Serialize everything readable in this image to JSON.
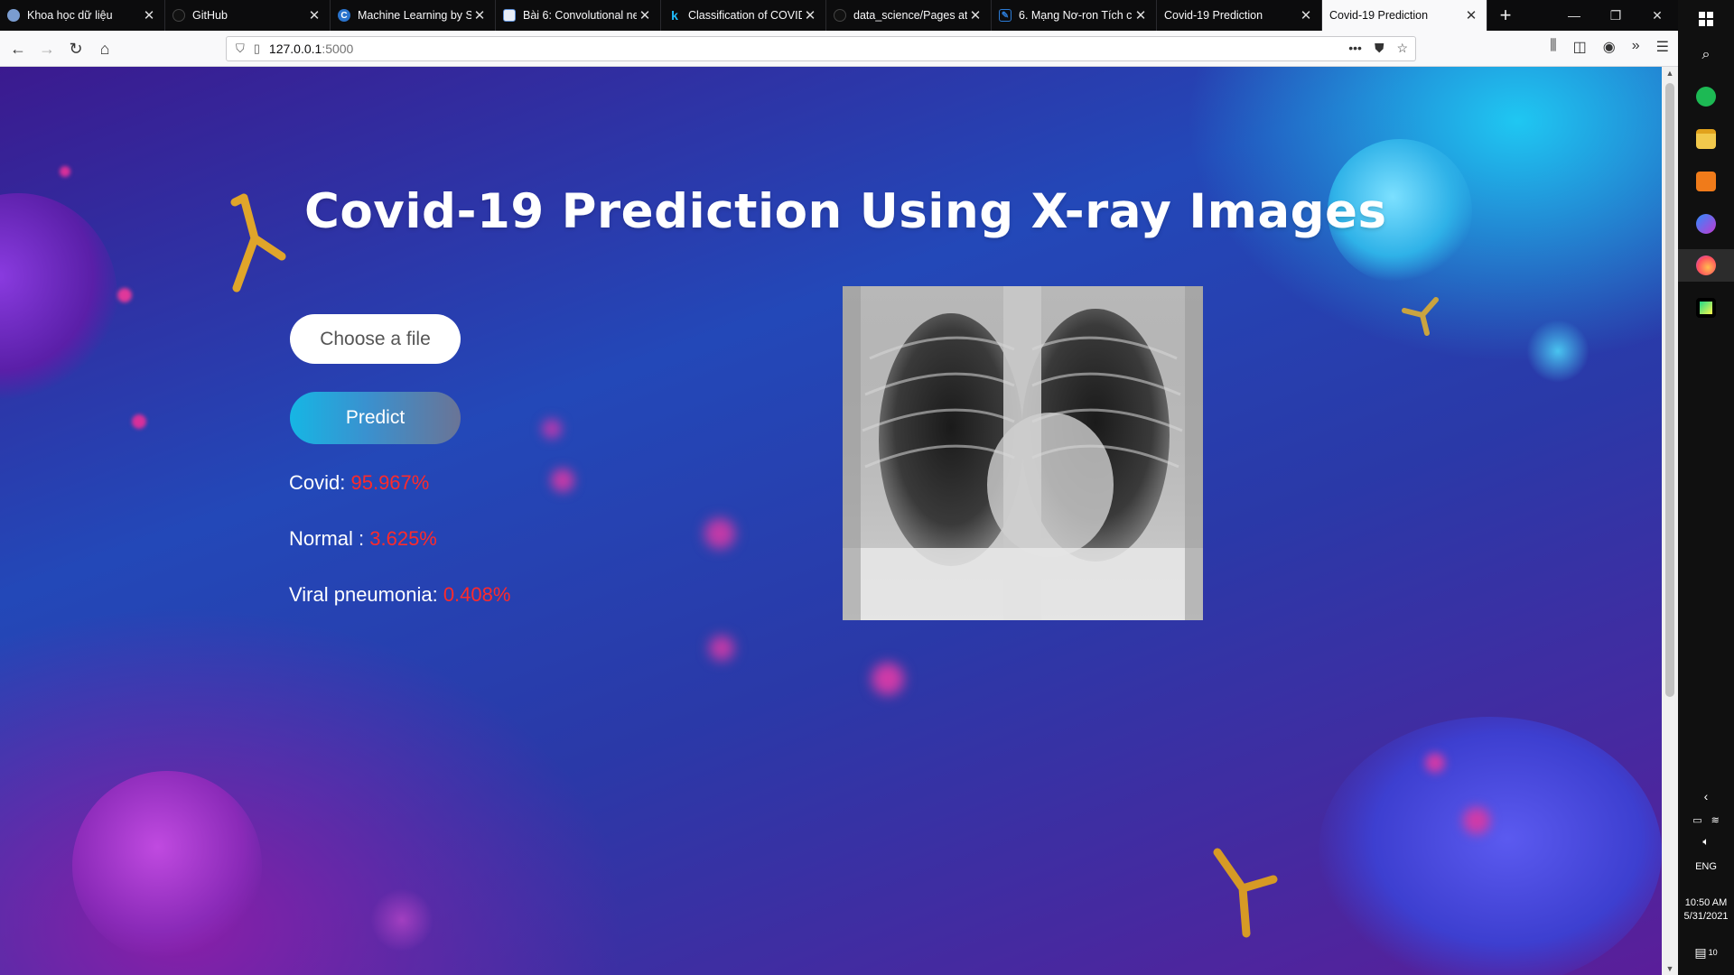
{
  "browser": {
    "tabs": [
      {
        "title": "Khoa học dữ liệu",
        "icon": "ai-logo-icon",
        "color": "#7a9cd0"
      },
      {
        "title": "GitHub",
        "icon": "github-icon",
        "color": "#111111"
      },
      {
        "title": "Machine Learning by S",
        "icon": "coursera-c-icon",
        "color": "#2a73cc"
      },
      {
        "title": "Bài 6: Convolutional ne",
        "icon": "document-icon",
        "color": "#5b8dd6"
      },
      {
        "title": "Classification of COVID",
        "icon": "kaggle-k-icon",
        "color": "#20beff"
      },
      {
        "title": "data_science/Pages at",
        "icon": "github-icon",
        "color": "#111111"
      },
      {
        "title": "6. Mạng Nơ-ron Tích c",
        "icon": "edit-icon",
        "color": "#2b7bd6"
      },
      {
        "title": "Covid-19 Prediction",
        "icon": "page-icon",
        "color": "#888888"
      },
      {
        "title": "Covid-19 Prediction",
        "icon": "page-icon",
        "color": "#888888",
        "active": true
      }
    ],
    "new_tab": "+",
    "url_host": "127.0.0.1",
    "url_port": ":5000"
  },
  "page": {
    "title": "Covid-19 Prediction Using X-ray Images",
    "choose_file_label": "Choose a file",
    "predict_label": "Predict",
    "results": [
      {
        "label": "Covid: ",
        "value": "95.967%"
      },
      {
        "label": "Normal : ",
        "value": "3.625%"
      },
      {
        "label": "Viral pneumonia: ",
        "value": "0.408%"
      }
    ]
  },
  "taskbar": {
    "lang": "ENG",
    "time": "10:50 AM",
    "date": "5/31/2021",
    "notifications": "10"
  },
  "colors": {
    "result_value": "#ff2a2a",
    "predict_gradient_start": "#16b6e4",
    "predict_gradient_end": "#6a7496"
  }
}
